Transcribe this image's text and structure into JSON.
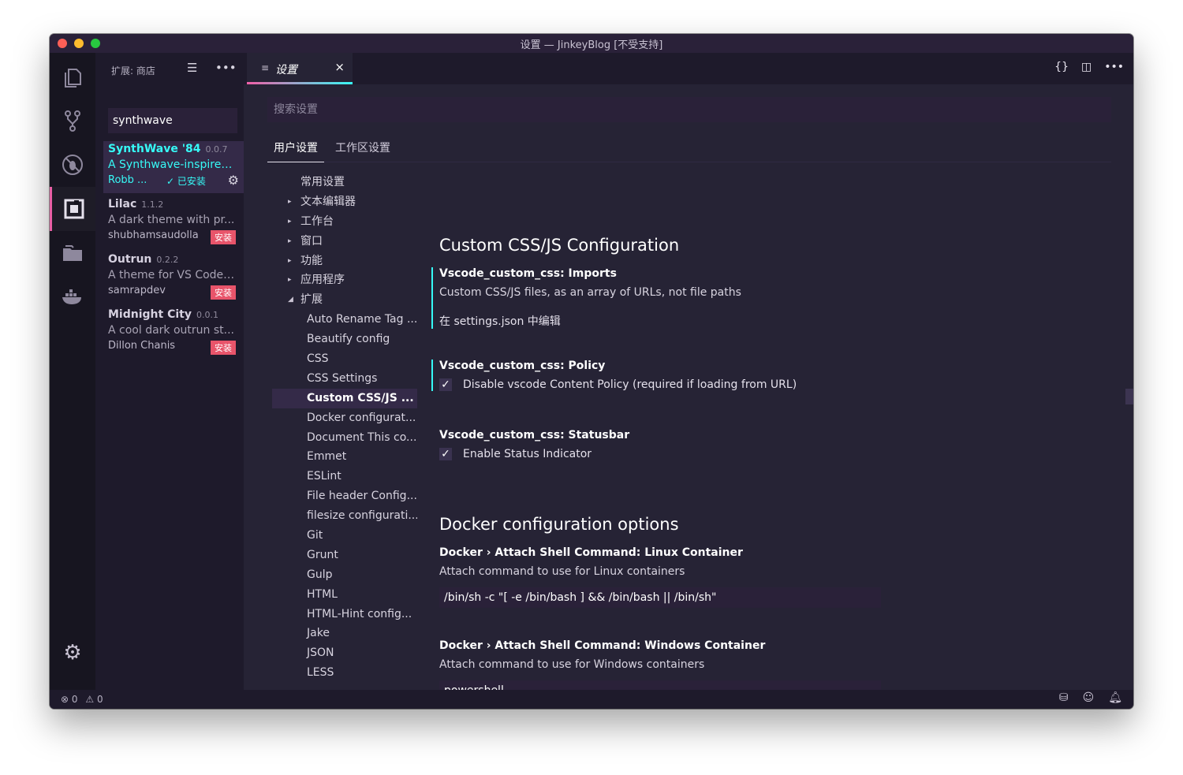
{
  "window": {
    "title": "设置 — JinkeyBlog [不受支持]"
  },
  "activity_bar": {
    "items": [
      {
        "icon": "explorer-icon"
      },
      {
        "icon": "source-control-icon"
      },
      {
        "icon": "debug-icon"
      },
      {
        "icon": "extensions-icon",
        "active": true
      },
      {
        "icon": "folder-icon"
      },
      {
        "icon": "docker-icon"
      }
    ],
    "manage_icon": "gear-icon"
  },
  "sidebar": {
    "header": "扩展: 商店",
    "search_value": "synthwave",
    "extensions": [
      {
        "name": "SynthWave '84",
        "version": "0.0.7",
        "description": "A Synthwave-inspired...",
        "publisher": "Robb ...",
        "status": "✓ 已安装",
        "selected": true
      },
      {
        "name": "Lilac",
        "version": "1.1.2",
        "description": "A dark theme with pr...",
        "publisher": "shubhamsaudolla",
        "action": "安装"
      },
      {
        "name": "Outrun",
        "version": "0.2.2",
        "description": "A theme for VS Code ...",
        "publisher": "samrapdev",
        "action": "安装"
      },
      {
        "name": "Midnight City",
        "version": "0.0.1",
        "description": "A cool dark outrun st...",
        "publisher": "Dillon Chanis",
        "action": "安装"
      }
    ]
  },
  "editor": {
    "tab_label": "设置",
    "tab_close": "×",
    "actions": [
      "{}",
      "split-editor-icon",
      "more-icon"
    ]
  },
  "settings": {
    "search_placeholder": "搜索设置",
    "scope_tabs": [
      "用户设置",
      "工作区设置"
    ],
    "toc": [
      {
        "label": "常用设置",
        "level": 0
      },
      {
        "label": "文本编辑器",
        "level": 0,
        "arrow": "▸"
      },
      {
        "label": "工作台",
        "level": 0,
        "arrow": "▸"
      },
      {
        "label": "窗口",
        "level": 0,
        "arrow": "▸"
      },
      {
        "label": "功能",
        "level": 0,
        "arrow": "▸"
      },
      {
        "label": "应用程序",
        "level": 0,
        "arrow": "▸"
      },
      {
        "label": "扩展",
        "level": 0,
        "arrow": "◢"
      },
      {
        "label": "Auto Rename Tag ...",
        "level": 1
      },
      {
        "label": "Beautify config",
        "level": 1
      },
      {
        "label": "CSS",
        "level": 1
      },
      {
        "label": "CSS Settings",
        "level": 1
      },
      {
        "label": "Custom CSS/JS ...",
        "level": 1,
        "active": true
      },
      {
        "label": "Docker configurat...",
        "level": 1
      },
      {
        "label": "Document This co...",
        "level": 1
      },
      {
        "label": "Emmet",
        "level": 1
      },
      {
        "label": "ESLint",
        "level": 1
      },
      {
        "label": "File header Config...",
        "level": 1
      },
      {
        "label": "filesize configurati...",
        "level": 1
      },
      {
        "label": "Git",
        "level": 1
      },
      {
        "label": "Grunt",
        "level": 1
      },
      {
        "label": "Gulp",
        "level": 1
      },
      {
        "label": "HTML",
        "level": 1
      },
      {
        "label": "HTML-Hint config...",
        "level": 1
      },
      {
        "label": "Jake",
        "level": 1
      },
      {
        "label": "JSON",
        "level": 1
      },
      {
        "label": "LESS",
        "level": 1
      }
    ],
    "group1": {
      "title": "Custom CSS/JS Configuration",
      "imports": {
        "title": "Vscode_custom_css: Imports",
        "description": "Custom CSS/JS files, as an array of URLs, not file paths",
        "link": "在 settings.json 中编辑"
      },
      "policy": {
        "title": "Vscode_custom_css: Policy",
        "checkbox_label": "Disable vscode Content Policy (required if loading from URL)",
        "checked": true
      },
      "statusbar": {
        "title": "Vscode_custom_css: Statusbar",
        "checkbox_label": "Enable Status Indicator",
        "checked": true
      }
    },
    "group2": {
      "title": "Docker configuration options",
      "linux": {
        "title": "Docker › Attach Shell Command: Linux Container",
        "description": "Attach command to use for Linux containers",
        "value": "/bin/sh -c \"[ -e /bin/bash ] && /bin/bash || /bin/sh\""
      },
      "windows": {
        "title": "Docker › Attach Shell Command: Windows Container",
        "description": "Attach command to use for Windows containers",
        "value": "powershell"
      }
    }
  },
  "statusbar": {
    "errors": "0",
    "warnings": "0"
  },
  "colors": {
    "accent_cyan": "#36f9f6",
    "accent_pink": "#f25ea7",
    "background": "#262335",
    "install_badge": "#e8546a"
  }
}
